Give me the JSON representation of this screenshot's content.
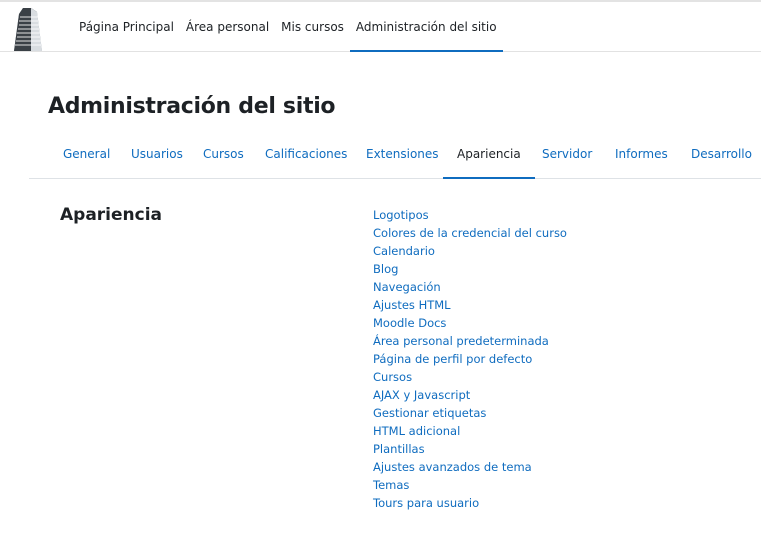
{
  "navbar": {
    "items": [
      {
        "label": "Página Principal",
        "active": false
      },
      {
        "label": "Área personal",
        "active": false
      },
      {
        "label": "Mis cursos",
        "active": false
      },
      {
        "label": "Administración del sitio",
        "active": true
      }
    ]
  },
  "page": {
    "title": "Administración del sitio"
  },
  "tabs": [
    {
      "label": "General",
      "active": false
    },
    {
      "label": "Usuarios",
      "active": false
    },
    {
      "label": "Cursos",
      "active": false
    },
    {
      "label": "Calificaciones",
      "active": false
    },
    {
      "label": "Extensiones",
      "active": false
    },
    {
      "label": "Apariencia",
      "active": true
    },
    {
      "label": "Servidor",
      "active": false
    },
    {
      "label": "Informes",
      "active": false
    },
    {
      "label": "Desarrollo",
      "active": false
    }
  ],
  "section": {
    "heading": "Apariencia",
    "links": [
      "Logotipos",
      "Colores de la credencial del curso",
      "Calendario",
      "Blog",
      "Navegación",
      "Ajustes HTML",
      "Moodle Docs",
      "Área personal predeterminada",
      "Página de perfil por defecto",
      "Cursos",
      "AJAX y Javascript",
      "Gestionar etiquetas",
      "HTML adicional",
      "Plantillas",
      "Ajustes avanzados de tema",
      "Temas",
      "Tours para usuario"
    ]
  },
  "colors": {
    "link": "#0f6cbf",
    "text": "#1d2125",
    "active_indicator": "#0f6cbf",
    "border": "#dee2e6"
  },
  "icons": {
    "logo": "building-tower-logo"
  }
}
